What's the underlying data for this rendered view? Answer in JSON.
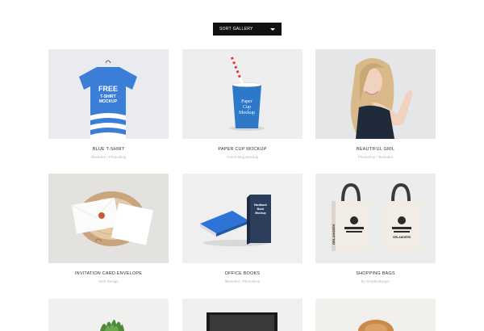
{
  "sort": {
    "label": "SORT GALLERY",
    "caret": "chevron-down-icon"
  },
  "gallery": [
    {
      "title": "BLUE T-SHIRT",
      "subtitle": "Illustrator / Photoshop",
      "tshirt_text": "FREE T-SHIRT MOCKUP"
    },
    {
      "title": "PAPER CUP MOCKUP",
      "subtitle": "Crane Mug Mockup",
      "cup_text": "Paper Cup Mockup"
    },
    {
      "title": "BEAUTIFUL GRIL",
      "subtitle": "Photoshop / Illustrator"
    },
    {
      "title": "INVITATION CARD ENVELOPE",
      "subtitle": "Web Design"
    },
    {
      "title": "OFFICE BOOKS",
      "subtitle": "Illustrator / Photoshop",
      "book_text": "Hardback Book Mockup"
    },
    {
      "title": "SHOPPING BAGS",
      "subtitle": "by GraphicBurger",
      "bag_text": "ORLANGERS"
    }
  ],
  "colors": {
    "accent_blue": "#3b7ed8",
    "sort_bg": "#111111"
  }
}
